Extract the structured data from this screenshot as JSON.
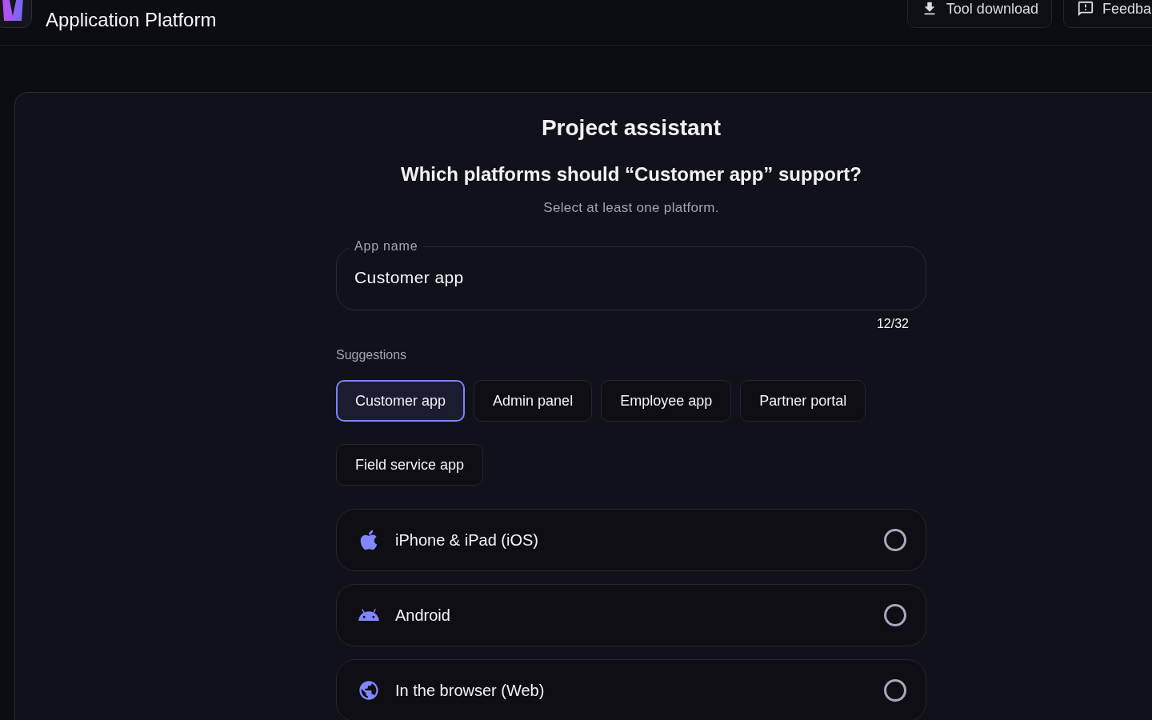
{
  "header": {
    "title": "Application Platform",
    "buttons": [
      {
        "label": "Tool download",
        "kind": "download"
      },
      {
        "label": "Feedba",
        "kind": "feedback"
      }
    ]
  },
  "assistant": {
    "title": "Project assistant",
    "question": "Which platforms should “Customer app” support?",
    "hint": "Select at least one platform.",
    "app_name": {
      "label": "App name",
      "value": "Customer app",
      "counter": "12/32"
    },
    "suggestions": {
      "label": "Suggestions",
      "items": [
        {
          "label": "Customer app",
          "selected": true
        },
        {
          "label": "Admin panel",
          "selected": false
        },
        {
          "label": "Employee app",
          "selected": false
        },
        {
          "label": "Partner portal",
          "selected": false
        },
        {
          "label": "Field service app",
          "selected": false
        }
      ]
    },
    "platforms": [
      {
        "label": "iPhone & iPad (iOS)",
        "kind": "apple",
        "selected": false
      },
      {
        "label": "Android",
        "kind": "android",
        "selected": false
      },
      {
        "label": "In the browser (Web)",
        "kind": "web",
        "selected": false
      }
    ]
  }
}
